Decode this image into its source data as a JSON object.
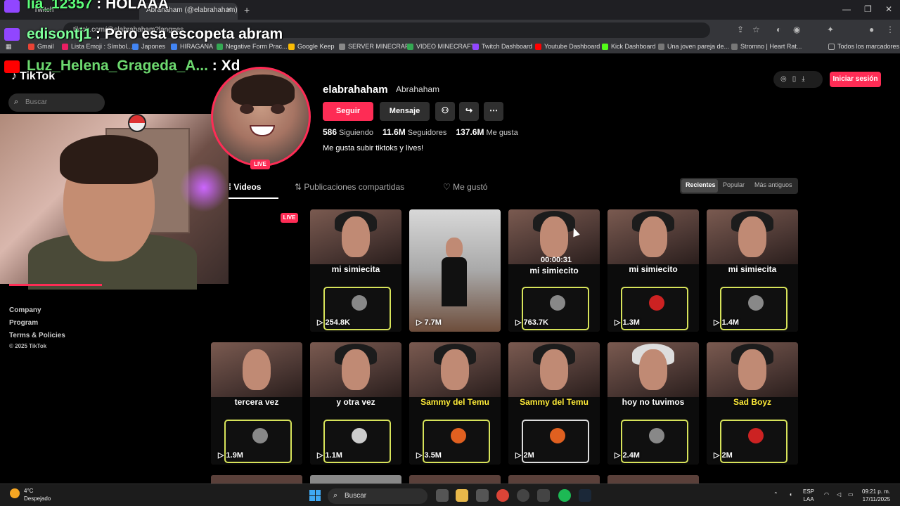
{
  "browser": {
    "tabs": [
      {
        "label": "Twitch"
      },
      {
        "label": "Abrahaham (@elabrahaham) | Ti"
      }
    ],
    "url": "tiktok.com/@elabrahaham?lang=es",
    "bookmarks": [
      {
        "label": "Gmail",
        "color": "#ea4335"
      },
      {
        "label": "Lista Emoji : Símbol...",
        "color": "#e91e63"
      },
      {
        "label": "Japones",
        "color": "#4285f4"
      },
      {
        "label": "HIRAGANA",
        "color": "#4285f4"
      },
      {
        "label": "Negative Form Prac...",
        "color": "#34a853"
      },
      {
        "label": "Google Keep",
        "color": "#fbbc04"
      },
      {
        "label": "SERVER MINECRAFT",
        "color": "#888888"
      },
      {
        "label": "VIDEO MINECRAFT",
        "color": "#34a853"
      },
      {
        "label": "Twitch Dashboard",
        "color": "#9146ff"
      },
      {
        "label": "Youtube Dashboard",
        "color": "#ff0000"
      },
      {
        "label": "Kick Dashboard",
        "color": "#53fc18"
      },
      {
        "label": "Una joven pareja de...",
        "color": "#777777"
      },
      {
        "label": "Stromno | Heart Rat...",
        "color": "#777777"
      }
    ],
    "all_bookmarks": "Todos los marcadores"
  },
  "chat": [
    {
      "user": "lia_12357",
      "message": "HOLAAA"
    },
    {
      "user": "edisontj1",
      "message": "Pero esa escopeta abram"
    },
    {
      "user": "Luz_Helena_Grageda_A...",
      "message": "Xd"
    }
  ],
  "tiktok": {
    "logo": "TikTok",
    "search_placeholder": "Buscar",
    "footer": {
      "company": "Company",
      "program": "Program",
      "terms": "Terms & Policies",
      "copyright": "© 2025 TikTok"
    },
    "login": "Iniciar sesión"
  },
  "profile": {
    "username": "elabrahaham",
    "nickname": "Abrahaham",
    "live": "LIVE",
    "follow": "Seguir",
    "message": "Mensaje",
    "following_count": "586",
    "following_label": "Siguiendo",
    "followers_count": "11.6M",
    "followers_label": "Seguidores",
    "likes_count": "137.6M",
    "likes_label": "Me gusta",
    "bio": "Me gusta subir tiktoks y lives!"
  },
  "tabs": [
    {
      "label": "Videos"
    },
    {
      "label": "Publicaciones compartidas"
    },
    {
      "label": "Me gustó"
    }
  ],
  "sort": [
    "Recientes",
    "Popular",
    "Más antiguos"
  ],
  "videos_row1": [
    {
      "caption": "mi simiecita",
      "views": "254.8K",
      "yellow": false
    },
    {
      "caption": "",
      "views": "7.7M",
      "yellow": false
    },
    {
      "caption": "mi simiecito",
      "views": "763.7K",
      "yellow": false
    },
    {
      "caption": "mi simiecito",
      "views": "1.3M",
      "yellow": false
    },
    {
      "caption": "mi simiecita",
      "views": "1.4M",
      "yellow": false
    }
  ],
  "videos_row2": [
    {
      "caption": "tercera vez",
      "views": "1.9M",
      "yellow": false
    },
    {
      "caption": "y otra vez",
      "views": "1.1M",
      "yellow": false
    },
    {
      "caption": "Sammy del Temu",
      "views": "3.5M",
      "yellow": true
    },
    {
      "caption": "Sammy del Temu",
      "views": "2M",
      "yellow": true
    },
    {
      "caption": "hoy no tuvimos",
      "views": "2.4M",
      "yellow": false
    },
    {
      "caption": "Sad Boyz",
      "views": "2M",
      "yellow": true
    }
  ],
  "hover_time": "00:00:31",
  "taskbar": {
    "temp": "4°C",
    "weather": "Despejado",
    "search": "Buscar",
    "lang1": "ESP",
    "lang2": "LAA",
    "time": "09:21 p. m.",
    "date": "17/11/2025"
  }
}
